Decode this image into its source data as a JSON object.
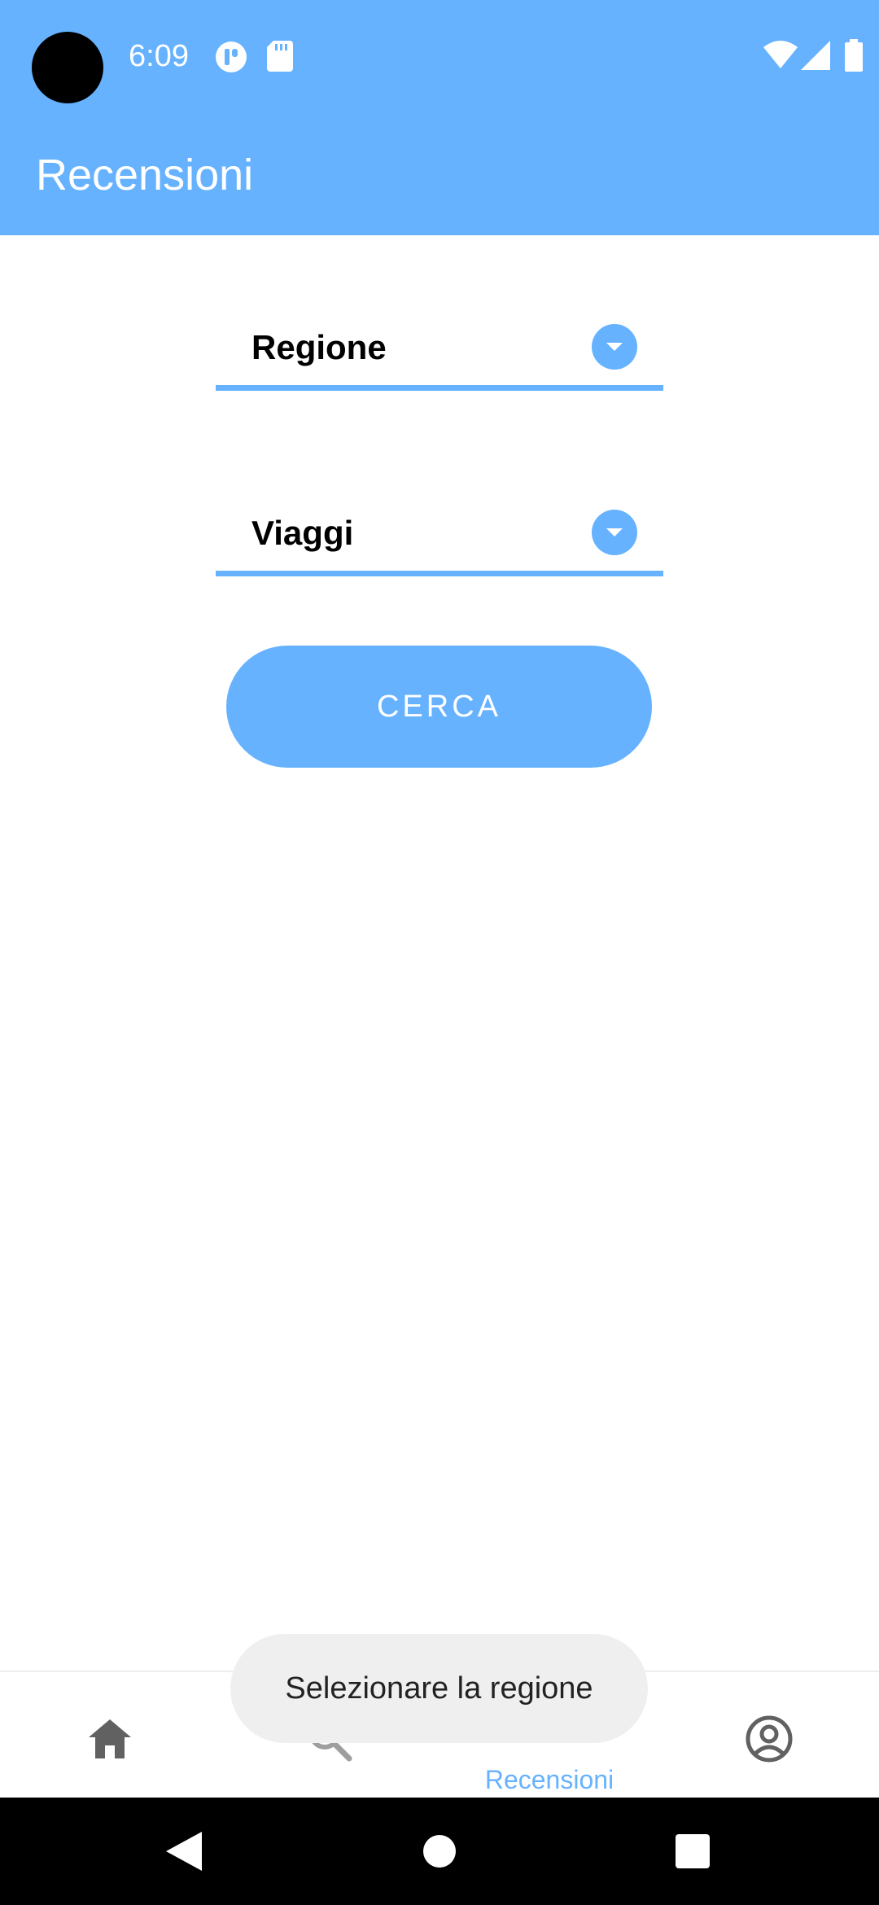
{
  "status_bar": {
    "time": "6:09"
  },
  "app_bar": {
    "title": "Recensioni"
  },
  "form": {
    "region_dropdown_label": "Regione",
    "trips_dropdown_label": "Viaggi",
    "search_button_label": "CERCA"
  },
  "bottom_nav": {
    "items": [
      {
        "icon": "home-icon",
        "label": ""
      },
      {
        "icon": "search-icon",
        "label": ""
      },
      {
        "icon": "edit-pencil-icon",
        "label": "Recensioni",
        "active": true
      },
      {
        "icon": "account-circle-icon",
        "label": ""
      }
    ]
  },
  "toast": {
    "message": "Selezionare la regione"
  },
  "colors": {
    "primary": "#66b2ff",
    "background": "#ffffff",
    "toast_bg": "#efefef",
    "nav_icon": "#616161",
    "system_nav_bg": "#000000"
  },
  "system_nav": {
    "icons": [
      "back-icon",
      "home-circle-icon",
      "recents-square-icon"
    ]
  }
}
